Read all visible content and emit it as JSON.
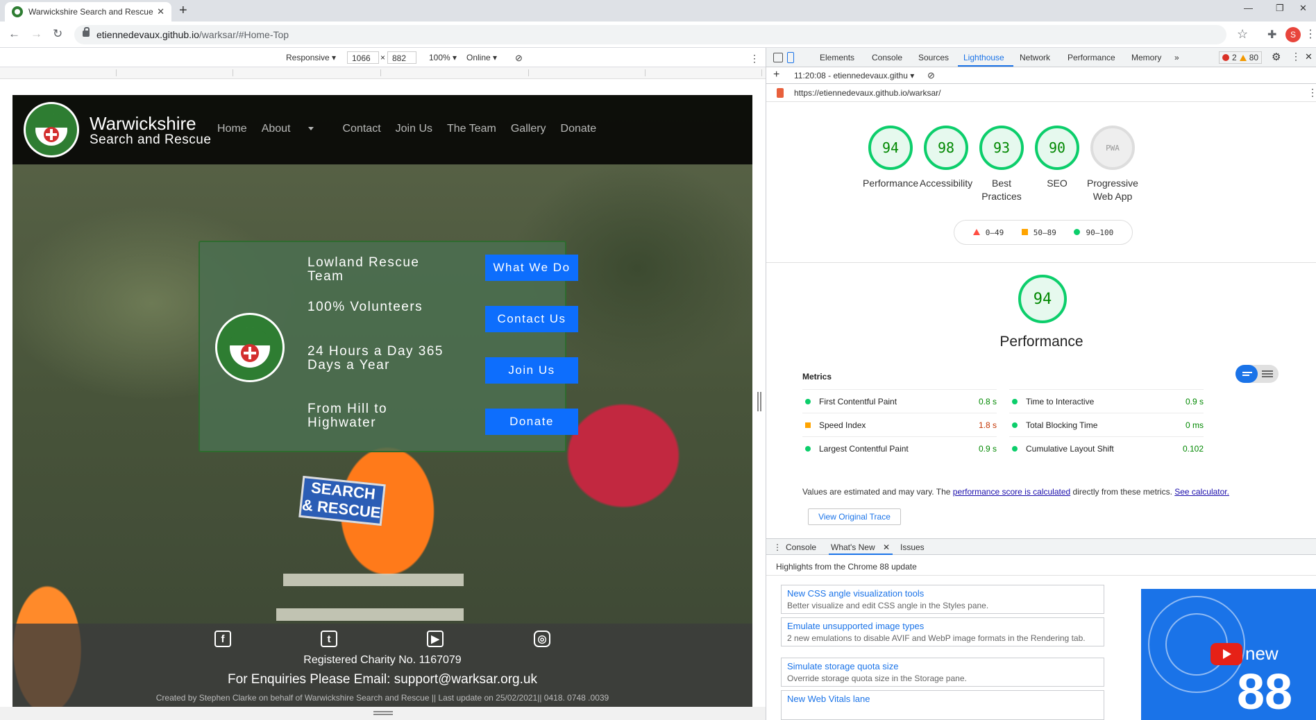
{
  "browser": {
    "tab_title": "Warwickshire Search and Rescue",
    "url_host": "etiennedevaux.github.io",
    "url_path": "/warksar/#Home-Top",
    "avatar_letter": "S"
  },
  "device_toolbar": {
    "mode": "Responsive ▾",
    "width": "1066",
    "times": "×",
    "height": "882",
    "zoom": "100% ▾",
    "network": "Online ▾"
  },
  "site": {
    "brand_line1": "Warwickshire",
    "brand_line2": "Search and Rescue",
    "nav": [
      "Home",
      "About",
      "Contact",
      "Join Us",
      "The Team",
      "Gallery",
      "Donate"
    ],
    "badge_text": "SEARCH & RESCUE",
    "panel": {
      "texts": [
        "Lowland Rescue Team",
        "100% Volunteers",
        "24 Hours a Day 365 Days a Year",
        "From Hill to Highwater"
      ],
      "buttons": [
        "What We Do",
        "Contact Us",
        "Join Us",
        "Donate"
      ]
    },
    "footer": {
      "charity": "Registered Charity No. 1167079",
      "enquiries": "For Enquiries Please Email: support@warksar.org.uk",
      "credits": "Created by Stephen Clarke on behalf of Warwickshire Search and Rescue || Last update on 25/02/2021|| 0418. 0748 .0039"
    }
  },
  "devtools": {
    "tabs": [
      "Elements",
      "Console",
      "Sources",
      "Lighthouse",
      "Network",
      "Performance",
      "Memory",
      "»"
    ],
    "error_count": "2",
    "warning_count": "80",
    "report_select": "11:20:08 - etiennedevaux.githu ▾",
    "report_url": "https://etiennedevaux.github.io/warksar/",
    "scores": [
      {
        "value": "94",
        "label": "Performance"
      },
      {
        "value": "98",
        "label": "Accessibility"
      },
      {
        "value": "93",
        "label": "Best Practices"
      },
      {
        "value": "90",
        "label": "SEO"
      },
      {
        "value": "PWA",
        "label": "Progressive Web App"
      }
    ],
    "legend": [
      "0–49",
      "50–89",
      "90–100"
    ],
    "perf_score": "94",
    "perf_title": "Performance",
    "metrics_heading": "Metrics",
    "metrics": [
      {
        "name": "First Contentful Paint",
        "value": "0.8 s",
        "status": "good"
      },
      {
        "name": "Time to Interactive",
        "value": "0.9 s",
        "status": "good"
      },
      {
        "name": "Speed Index",
        "value": "1.8 s",
        "status": "average"
      },
      {
        "name": "Total Blocking Time",
        "value": "0 ms",
        "status": "good"
      },
      {
        "name": "Largest Contentful Paint",
        "value": "0.9 s",
        "status": "good"
      },
      {
        "name": "Cumulative Layout Shift",
        "value": "0.102",
        "status": "good"
      }
    ],
    "note_pre": "Values are estimated and may vary. The ",
    "note_link1": "performance score is calculated",
    "note_mid": " directly from these metrics. ",
    "note_link2": "See calculator.",
    "trace_button": "View Original Trace",
    "drawer_tabs": [
      "Console",
      "What's New",
      "Issues"
    ],
    "whats_new_heading": "Highlights from the Chrome 88 update",
    "cards": [
      {
        "title": "New CSS angle visualization tools",
        "desc": "Better visualize and edit CSS angle in the Styles pane."
      },
      {
        "title": "Emulate unsupported image types",
        "desc": "2 new emulations to disable AVIF and WebP image formats in the Rendering tab."
      },
      {
        "title": "Simulate storage quota size",
        "desc": "Override storage quota size in the Storage pane."
      },
      {
        "title": "New Web Vitals lane",
        "desc": ""
      }
    ],
    "promo_new": "new",
    "promo_number": "88"
  }
}
